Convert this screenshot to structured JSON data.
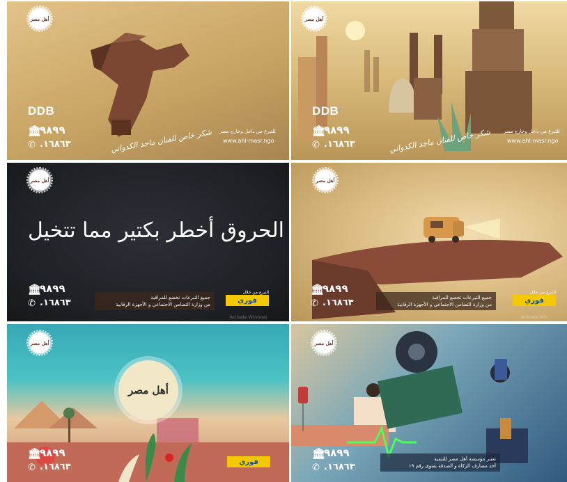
{
  "tiles": [
    {
      "logo": "أهل مصر",
      "ddb": "DDB",
      "hotline_bank": "٩٨٩٩",
      "hotline_phone": ".١٦٨٦٣",
      "thanks": "شكر خاص للفنان ماجد الكدواني",
      "donate_note": "للتبرع من داخل وخارج مصر",
      "website": "www.ahl-masr.ngo"
    },
    {
      "logo": "أهل مصر",
      "ddb": "DDB",
      "hotline_bank": "٩٨٩٩",
      "hotline_phone": ".١٦٨٦٣",
      "thanks": "شكر خاص للفنان ماجد الكدواني",
      "donate_note": "للتبرع من داخل وخارج مصر",
      "website": "www.ahl-masr.ngo"
    },
    {
      "logo": "أهل مصر",
      "title": "الحروق أخطر بكتير مما تتخيل",
      "hotline_bank": "٩٨٩٩",
      "hotline_phone": ".١٦٨٦٣",
      "notice_line1": "جميع التبرعات تخضع للمراقبة",
      "notice_line2": "من وزارة التضامن الاجتماعي و الأجهزة الرقابية",
      "fawry_caption": "التبرع من خلال",
      "fawry_label": "فوري",
      "watermark": "Activate Windows"
    },
    {
      "logo": "أهل مصر",
      "hotline_bank": "٩٨٩٩",
      "hotline_phone": ".١٦٨٦٣",
      "notice_line1": "جميع التبرعات تخضع للمراقبة",
      "notice_line2": "من وزارة التضامن الاجتماعي و الأجهزة الرقابية",
      "fawry_caption": "التبرع من خلال",
      "fawry_label": "فوري",
      "watermark": "Activate Win"
    },
    {
      "logo": "أهل مصر",
      "center_logo": "أهل مصر",
      "hotline_bank": "٩٨٩٩",
      "hotline_phone": ".١٦٨٦٣",
      "fawry_label": "فوري"
    },
    {
      "logo": "أهل مصر",
      "hotline_bank": "٩٨٩٩",
      "hotline_phone": ".١٦٨٦٣",
      "notice_line1": "تعتبر مؤسسة أهل مصر للتنمية",
      "notice_line2": "أحد مصارف الزكاة و الصدقة بفتوى رقم ١٩"
    }
  ],
  "colors": {
    "sand": "#c9a565",
    "dark_board": "#1d2024",
    "fawry_yellow": "#f5c900",
    "teal": "#3fb6b5"
  }
}
